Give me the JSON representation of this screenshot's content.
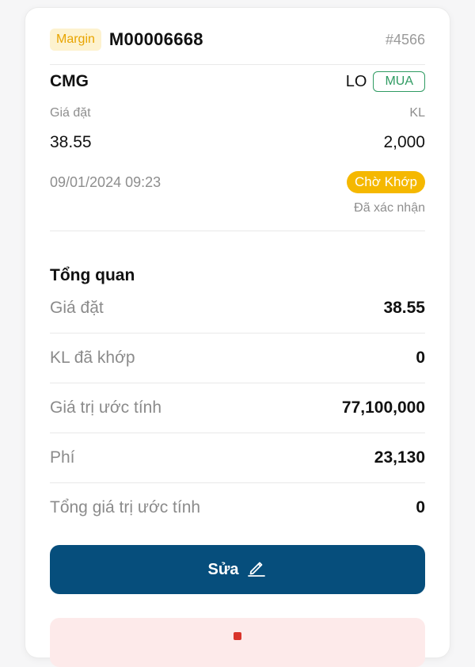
{
  "order": {
    "account_type": "Margin",
    "account_no": "M00006668",
    "order_id": "#4566",
    "symbol": "CMG",
    "lot_type": "LO",
    "side": "MUA",
    "price_label": "Giá đặt",
    "qty_label": "KL",
    "price": "38.55",
    "qty": "2,000",
    "timestamp": "09/01/2024 09:23",
    "status": "Chờ Khớp",
    "confirmation": "Đã xác nhận"
  },
  "overview": {
    "title": "Tổng quan",
    "rows": [
      {
        "label": "Giá đặt",
        "value": "38.55"
      },
      {
        "label": "KL đã khớp",
        "value": "0"
      },
      {
        "label": "Giá trị ước tính",
        "value": "77,100,000"
      },
      {
        "label": "Phí",
        "value": "23,130"
      },
      {
        "label": "Tổng giá trị ước tính",
        "value": "0"
      }
    ]
  },
  "actions": {
    "edit_label": "Sửa",
    "edit_icon": "pencil-icon"
  },
  "colors": {
    "primary": "#064e7c",
    "buy_green": "#2f9b62",
    "pending_yellow": "#f5b800",
    "margin_text": "#e8a400",
    "cancel_bg": "#fdeaea",
    "cancel_red": "#d9342b"
  }
}
